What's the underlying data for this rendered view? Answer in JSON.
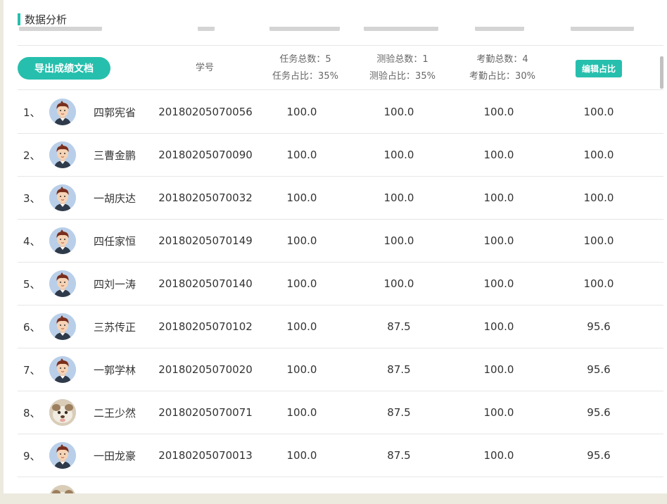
{
  "page": {
    "title": "数据分析"
  },
  "header": {
    "export_label": "导出成绩文档",
    "student_id_label": "学号",
    "task_total": "任务总数：5",
    "task_ratio": "任务占比：35%",
    "quiz_total": "测验总数：1",
    "quiz_ratio": "测验占比：35%",
    "attendance_total": "考勤总数：4",
    "attendance_ratio": "考勤占比：30%",
    "edit_label": "编辑占比"
  },
  "rows": [
    {
      "index": "1、",
      "avatar": "boy-avatar-icon",
      "name": "四郭宪省",
      "student_id": "20180205070056",
      "task": "100.0",
      "quiz": "100.0",
      "attendance": "100.0",
      "total": "100.0"
    },
    {
      "index": "2、",
      "avatar": "boy-avatar-icon",
      "name": "三曹金鹏",
      "student_id": "20180205070090",
      "task": "100.0",
      "quiz": "100.0",
      "attendance": "100.0",
      "total": "100.0"
    },
    {
      "index": "3、",
      "avatar": "boy-avatar-icon",
      "name": "一胡庆达",
      "student_id": "20180205070032",
      "task": "100.0",
      "quiz": "100.0",
      "attendance": "100.0",
      "total": "100.0"
    },
    {
      "index": "4、",
      "avatar": "boy-avatar-icon",
      "name": "四任家恒",
      "student_id": "20180205070149",
      "task": "100.0",
      "quiz": "100.0",
      "attendance": "100.0",
      "total": "100.0"
    },
    {
      "index": "5、",
      "avatar": "boy-avatar-icon",
      "name": "四刘一涛",
      "student_id": "20180205070140",
      "task": "100.0",
      "quiz": "100.0",
      "attendance": "100.0",
      "total": "100.0"
    },
    {
      "index": "6、",
      "avatar": "boy-avatar-icon",
      "name": "三苏传正",
      "student_id": "20180205070102",
      "task": "100.0",
      "quiz": "87.5",
      "attendance": "100.0",
      "total": "95.6"
    },
    {
      "index": "7、",
      "avatar": "boy-avatar-icon",
      "name": "一郭学林",
      "student_id": "20180205070020",
      "task": "100.0",
      "quiz": "87.5",
      "attendance": "100.0",
      "total": "95.6"
    },
    {
      "index": "8、",
      "avatar": "photo-avatar-icon",
      "name": "二王少然",
      "student_id": "20180205070071",
      "task": "100.0",
      "quiz": "87.5",
      "attendance": "100.0",
      "total": "95.6"
    },
    {
      "index": "9、",
      "avatar": "boy-avatar-icon",
      "name": "一田龙豪",
      "student_id": "20180205070013",
      "task": "100.0",
      "quiz": "87.5",
      "attendance": "100.0",
      "total": "95.6"
    },
    {
      "index": "",
      "avatar": "photo-avatar-icon",
      "name": "",
      "student_id": "",
      "task": "",
      "quiz": "",
      "attendance": "",
      "total": ""
    }
  ],
  "colors": {
    "accent": "#26bfad",
    "divider": "#e6e6e6",
    "background": "#ece9df"
  }
}
